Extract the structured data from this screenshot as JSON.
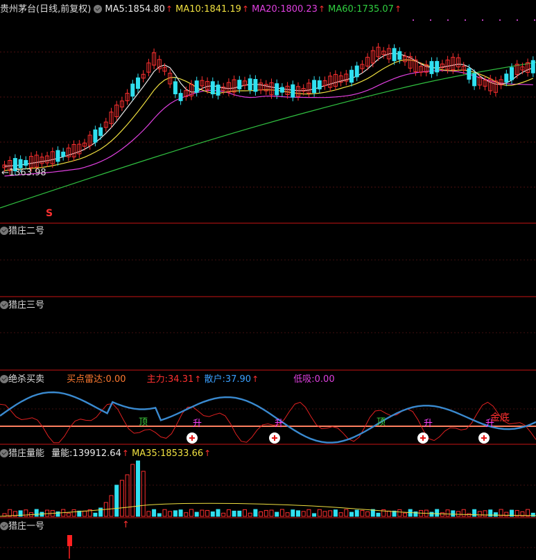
{
  "main": {
    "title": "贵州茅台(日线,前复权)",
    "ma": [
      {
        "label": "MA5:",
        "value": "1854.80",
        "color": "#e8e8e8"
      },
      {
        "label": "MA10:",
        "value": "1841.19",
        "color": "#f0e040"
      },
      {
        "label": "MA20:",
        "value": "1800.23",
        "color": "#e040e0"
      },
      {
        "label": "MA60:",
        "value": "1735.07",
        "color": "#30d040"
      }
    ],
    "low_label": "←1363.98",
    "signal_s": "S",
    "arrow": "↑"
  },
  "panels": {
    "p2": {
      "title": "猎庄二号"
    },
    "p3": {
      "title": "猎庄三号"
    },
    "p4": {
      "title": "绝杀买卖",
      "items": [
        {
          "label": "买点雷达:",
          "value": "0.00",
          "color": "#ff7a30"
        },
        {
          "label": "主力:",
          "value": "34.31",
          "color": "#ff3030",
          "arrow": "↑"
        },
        {
          "label": "散户:",
          "value": "37.90",
          "color": "#3aa0ff",
          "arrow": "↑"
        },
        {
          "label": "低吸:",
          "value": "0.00",
          "color": "#e040e0"
        }
      ],
      "marks": [
        "顶",
        "升",
        "升",
        "顶",
        "升",
        "升",
        "金底"
      ]
    },
    "p5": {
      "title": "猎庄量能",
      "items": [
        {
          "label": "量能:",
          "value": "139912.64",
          "color": "#e8e8e8",
          "arrow": "↑"
        },
        {
          "label": "MA35:",
          "value": "18533.66",
          "color": "#f0e040",
          "arrow": "↑"
        }
      ]
    },
    "p6": {
      "title": "猎庄一号"
    }
  },
  "colors": {
    "up": "#ff3030",
    "down": "#30e0f0",
    "sep": "#a01010"
  }
}
